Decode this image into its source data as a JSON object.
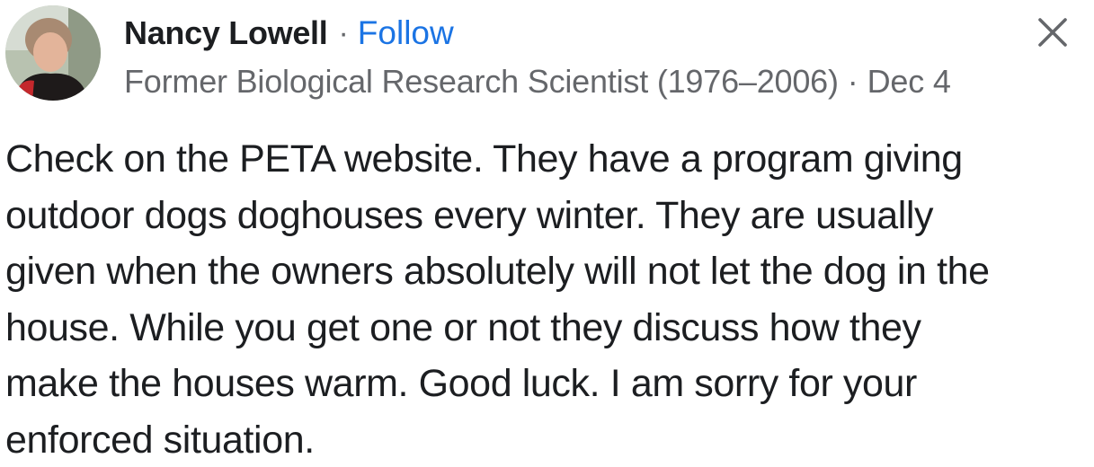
{
  "comment": {
    "author": {
      "name": "Nancy Lowell",
      "follow_label": "Follow",
      "subtitle": "Former Biological Research Scientist (1976–2006)",
      "date": "Dec 4",
      "separator": "·"
    },
    "body_lines": [
      "Check on the PETA website. They have a program giving",
      "outdoor dogs doghouses every winter. They are usually",
      "given when the owners absolutely will not let the dog in the",
      "house. While you get one or not they discuss how they",
      "make the houses warm. Good luck. I am sorry for your",
      "enforced situation."
    ]
  },
  "icons": {
    "avatar": "profile-photo",
    "close": "close-icon"
  },
  "colors": {
    "text": "#1c1e21",
    "secondary": "#65676b",
    "link": "#1b74e4"
  }
}
